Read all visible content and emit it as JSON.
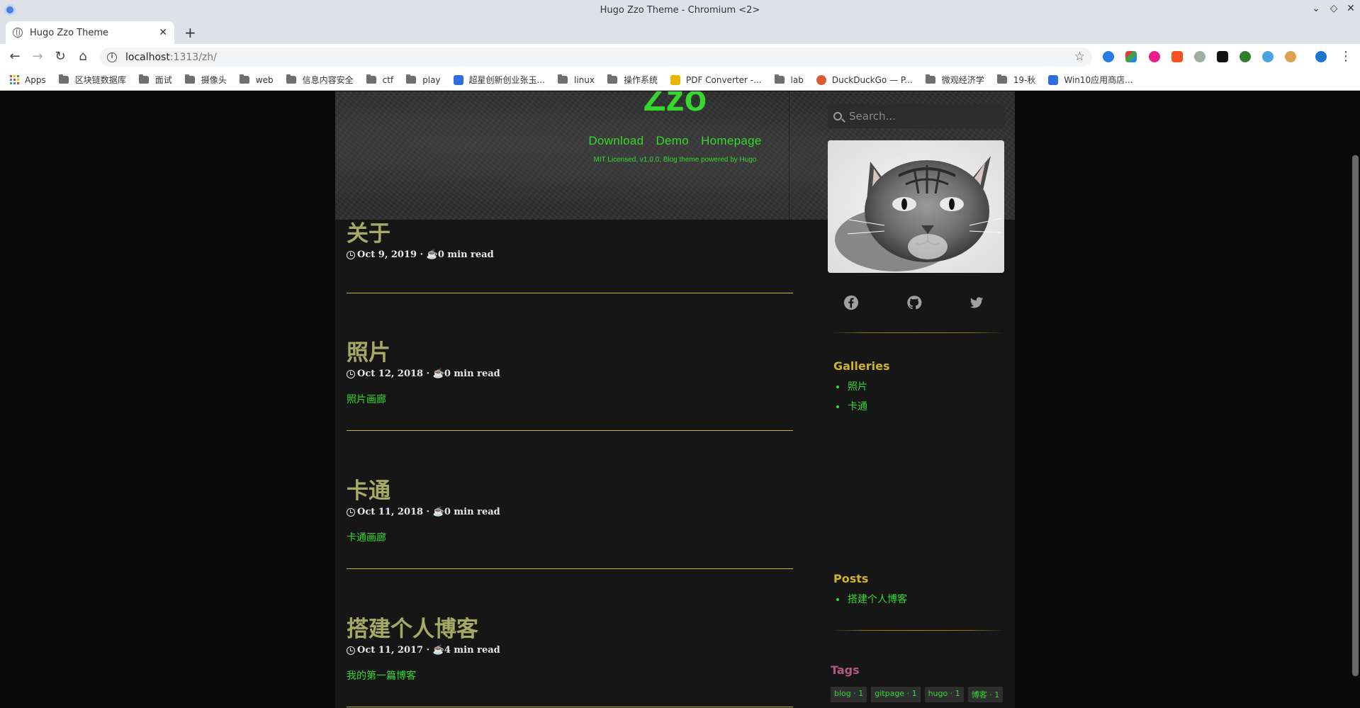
{
  "window": {
    "title": "Hugo Zzo Theme - Chromium <2>"
  },
  "tab": {
    "title": "Hugo Zzo Theme"
  },
  "address_bar": {
    "host": "localhost",
    "path": ":1313/zh/"
  },
  "bookmarks": [
    {
      "label": "Apps",
      "kind": "apps"
    },
    {
      "label": "区块链数据库",
      "kind": "folder"
    },
    {
      "label": "面试",
      "kind": "folder"
    },
    {
      "label": "摄像头",
      "kind": "folder"
    },
    {
      "label": "web",
      "kind": "folder"
    },
    {
      "label": "信息内容安全",
      "kind": "folder"
    },
    {
      "label": "ctf",
      "kind": "folder"
    },
    {
      "label": "play",
      "kind": "folder"
    },
    {
      "label": "超星创新创业张玉...",
      "kind": "paw",
      "color": "#2f6de0"
    },
    {
      "label": "linux",
      "kind": "folder"
    },
    {
      "label": "操作系统",
      "kind": "folder"
    },
    {
      "label": "PDF Converter -...",
      "kind": "pdf",
      "color": "#e8b400"
    },
    {
      "label": "lab",
      "kind": "folder"
    },
    {
      "label": "DuckDuckGo — P...",
      "kind": "duck",
      "color": "#de5833"
    },
    {
      "label": "微观经济学",
      "kind": "folder"
    },
    {
      "label": "19-秋",
      "kind": "folder"
    },
    {
      "label": "Win10应用商店...",
      "kind": "paw",
      "color": "#2f6de0"
    }
  ],
  "header": {
    "logo": "Zzo",
    "nav": [
      "Download",
      "Demo",
      "Homepage"
    ],
    "subnote": "MIT Licensed, v1.0.0, Blog theme powered by Hugo"
  },
  "posts": [
    {
      "title": "关于",
      "meta": "Oct 9, 2019 · ☕0 min read",
      "summary": ""
    },
    {
      "title": "照片",
      "meta": "Oct 12, 2018 · ☕0 min read",
      "summary": "照片画廊"
    },
    {
      "title": "卡通",
      "meta": "Oct 11, 2018 · ☕0 min read",
      "summary": "卡通画廊"
    },
    {
      "title": "搭建个人博客",
      "meta": "Oct 11, 2017 · ☕4 min read",
      "summary": "我的第一篇博客"
    }
  ],
  "sidebar": {
    "search_placeholder": "Search...",
    "galleries_heading": "Galleries",
    "galleries": [
      "照片",
      "卡通"
    ],
    "posts_heading": "Posts",
    "posts": [
      "搭建个人博客"
    ],
    "tags_heading": "Tags",
    "tags": [
      "blog · 1",
      "gitpage · 1",
      "hugo · 1",
      "博客 · 1"
    ]
  },
  "colors": {
    "accent": "#35d92e",
    "title": "#a5ab62",
    "rule": "#c6b42a",
    "side_heading": "#d0b427",
    "tags_heading": "#b05a86"
  }
}
